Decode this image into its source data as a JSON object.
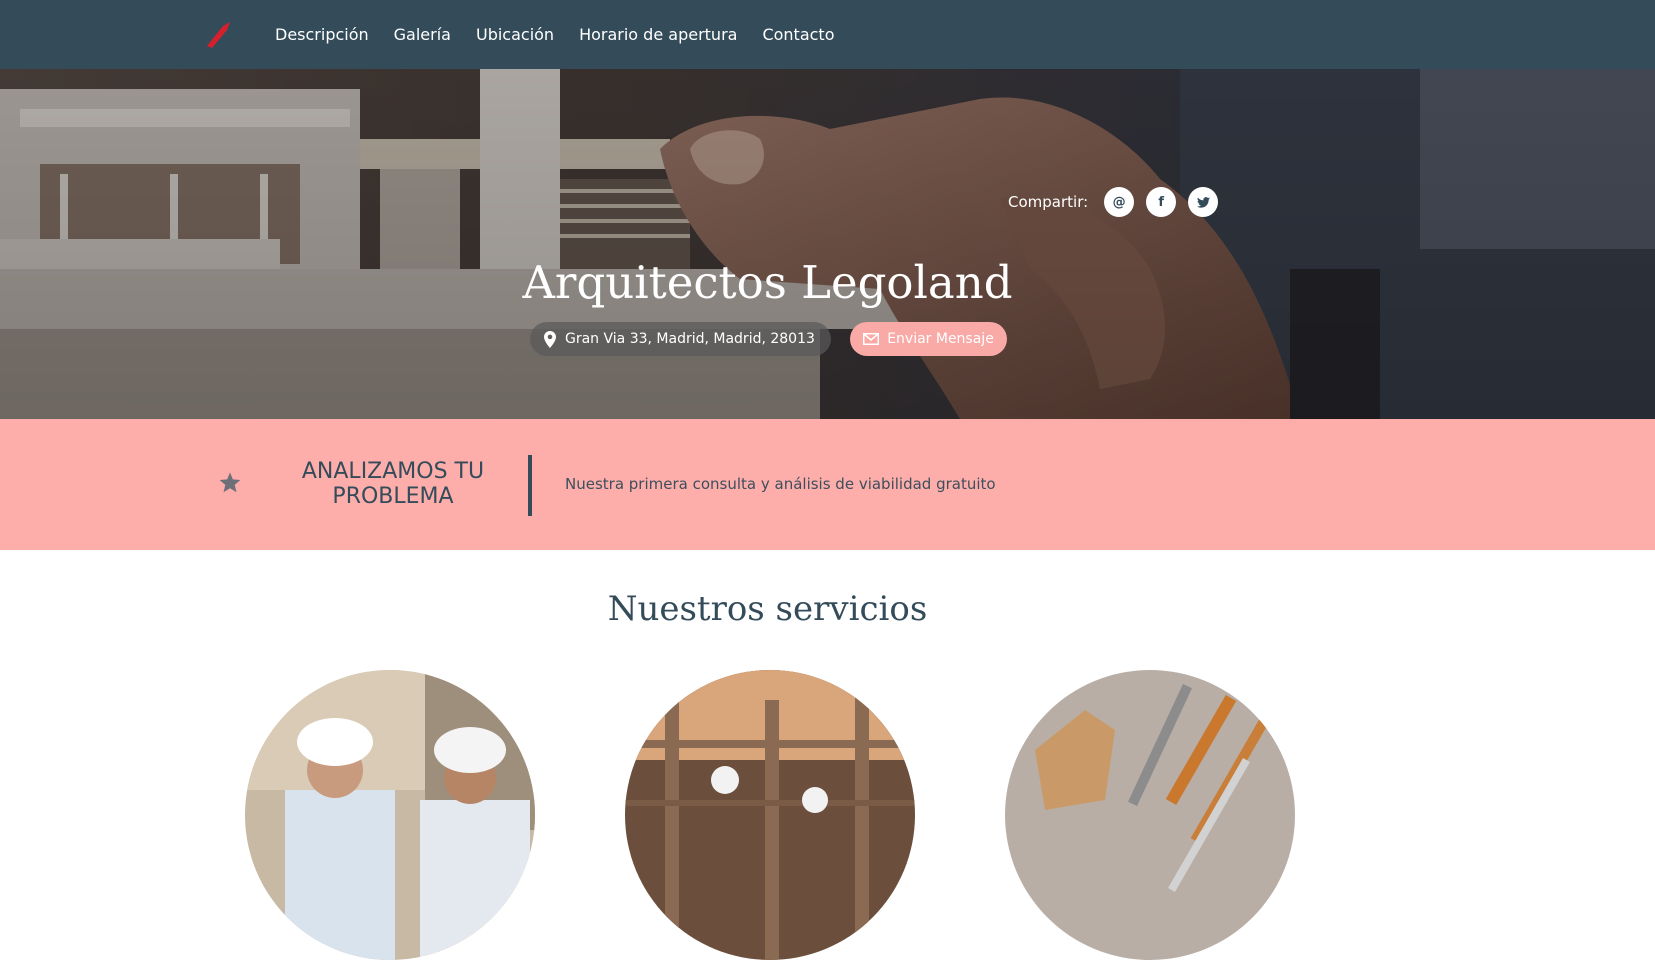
{
  "nav": {
    "items": [
      {
        "label": "Descripción"
      },
      {
        "label": "Galería"
      },
      {
        "label": "Ubicación"
      },
      {
        "label": "Horario de apertura"
      },
      {
        "label": "Contacto"
      }
    ]
  },
  "hero": {
    "share_label": "Compartir:",
    "share_buttons": [
      {
        "icon": "at-icon",
        "glyph": "@"
      },
      {
        "icon": "facebook-icon",
        "glyph": "f"
      },
      {
        "icon": "twitter-icon",
        "glyph": "t"
      }
    ],
    "title": "Arquitectos Legoland",
    "address": "Gran Via 33, Madrid, Madrid, 28013",
    "message_button": "Enviar Mensaje"
  },
  "promo": {
    "title": "ANALIZAMOS TU PROBLEMA",
    "text": "Nuestra primera consulta y análisis de viabilidad gratuito"
  },
  "services": {
    "title": "Nuestros servicios"
  },
  "colors": {
    "nav_bg": "#344b5a",
    "accent_pink": "#fdaeab",
    "button_pink": "#f9a9a6",
    "logo_red": "#d6202c"
  }
}
